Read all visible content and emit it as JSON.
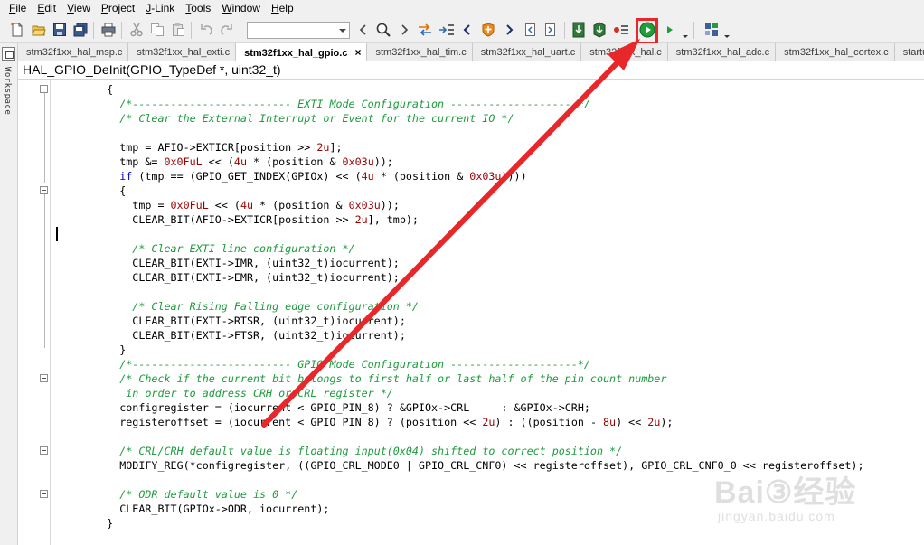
{
  "menu": [
    {
      "label": "File",
      "accel": "F",
      "rest": "ile"
    },
    {
      "label": "Edit",
      "accel": "E",
      "rest": "dit"
    },
    {
      "label": "View",
      "accel": "V",
      "rest": "iew"
    },
    {
      "label": "Project",
      "accel": "P",
      "rest": "roject"
    },
    {
      "label": "J-Link",
      "accel": "J",
      "rest": "-Link"
    },
    {
      "label": "Tools",
      "accel": "T",
      "rest": "ools"
    },
    {
      "label": "Window",
      "accel": "W",
      "rest": "indow"
    },
    {
      "label": "Help",
      "accel": "H",
      "rest": "elp"
    }
  ],
  "sidebar": {
    "label": "Workspace"
  },
  "tabs": [
    {
      "label": "stm32f1xx_hal_msp.c",
      "active": false
    },
    {
      "label": "stm32f1xx_hal_exti.c",
      "active": false
    },
    {
      "label": "stm32f1xx_hal_gpio.c",
      "active": true
    },
    {
      "label": "stm32f1xx_hal_tim.c",
      "active": false
    },
    {
      "label": "stm32f1xx_hal_uart.c",
      "active": false
    },
    {
      "label": "stm32f1xx_hal.c",
      "active": false
    },
    {
      "label": "stm32f1xx_hal_adc.c",
      "active": false
    },
    {
      "label": "stm32f1xx_hal_cortex.c",
      "active": false
    },
    {
      "label": "startup_s",
      "active": false
    }
  ],
  "tab_close_glyph": "×",
  "function_signature": "HAL_GPIO_DeInit(GPIO_TypeDef *, uint32_t)",
  "code_lines": [
    "    {",
    "      /*------------------------- EXTI Mode Configuration --------------------*/",
    "      /* Clear the External Interrupt or Event for the current IO */",
    "",
    "      tmp = AFIO->EXTICR[position >> 2u];",
    "      tmp &= 0x0FuL << (4u * (position & 0x03u));",
    "      if (tmp == (GPIO_GET_INDEX(GPIOx) << (4u * (position & 0x03u))))",
    "      {",
    "        tmp = 0x0FuL << (4u * (position & 0x03u));",
    "        CLEAR_BIT(AFIO->EXTICR[position >> 2u], tmp);",
    "",
    "        /* Clear EXTI line configuration */",
    "        CLEAR_BIT(EXTI->IMR, (uint32_t)iocurrent);",
    "        CLEAR_BIT(EXTI->EMR, (uint32_t)iocurrent);",
    "",
    "        /* Clear Rising Falling edge configuration */",
    "        CLEAR_BIT(EXTI->RTSR, (uint32_t)iocurrent);",
    "        CLEAR_BIT(EXTI->FTSR, (uint32_t)iocurrent);",
    "      }",
    "      /*------------------------- GPIO Mode Configuration --------------------*/",
    "      /* Check if the current bit belongs to first half or last half of the pin count number",
    "       in order to address CRH or CRL register */",
    "      configregister = (iocurrent < GPIO_PIN_8) ? &GPIOx->CRL     : &GPIOx->CRH;",
    "      registeroffset = (iocurrent < GPIO_PIN_8) ? (position << 2u) : ((position - 8u) << 2u);",
    "",
    "      /* CRL/CRH default value is floating input(0x04) shifted to correct position */",
    "      MODIFY_REG(*configregister, ((GPIO_CRL_MODE0 | GPIO_CRL_CNF0) << registeroffset), GPIO_CRL_CNF0_0 << registeroffset);",
    "",
    "      /* ODR default value is 0 */",
    "      CLEAR_BIT(GPIOx->ODR, iocurrent);",
    "    }"
  ],
  "watermark": {
    "brand": "Bai③经验",
    "url": "jingyan.baidu.com"
  },
  "colors": {
    "comment": "#1d9b3d",
    "number": "#9a0000",
    "keyword": "#0000c8",
    "highlight": "#e8272a",
    "run": "#1f9e3a"
  },
  "icons": [
    "new-file-icon",
    "open-folder-icon",
    "save-icon",
    "save-all-icon",
    "print-icon",
    "cut-icon",
    "copy-icon",
    "paste-icon",
    "undo-icon",
    "redo-icon",
    "find-prev-icon",
    "search-icon",
    "find-next-icon",
    "toggle-bookmark-icon",
    "goto-icon",
    "nav-back-icon",
    "insert-breakpoint-icon",
    "nav-forward-icon",
    "prev-file-icon",
    "next-file-icon",
    "download-icon",
    "download-debug-icon",
    "disasm-icon",
    "run-debug-icon",
    "run-icon",
    "project-icon"
  ]
}
